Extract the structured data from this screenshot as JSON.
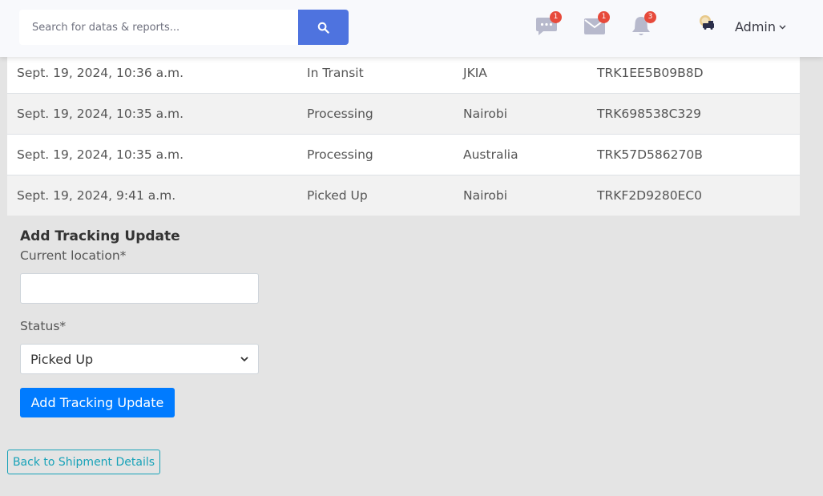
{
  "topbar": {
    "search_placeholder": "Search for datas & reports...",
    "messages_count": "1",
    "mail_count": "1",
    "alerts_count": "3",
    "user_name": "Admin"
  },
  "tracking_rows": [
    {
      "date": "Sept. 19, 2024, 10:36 a.m.",
      "status": "In Transit",
      "location": "JKIA",
      "tracking": "TRK1EE5B09B8D"
    },
    {
      "date": "Sept. 19, 2024, 10:35 a.m.",
      "status": "Processing",
      "location": "Nairobi",
      "tracking": "TRK698538C329"
    },
    {
      "date": "Sept. 19, 2024, 10:35 a.m.",
      "status": "Processing",
      "location": "Australia",
      "tracking": "TRK57D586270B"
    },
    {
      "date": "Sept. 19, 2024, 9:41 a.m.",
      "status": "Picked Up",
      "location": "Nairobi",
      "tracking": "TRKF2D9280EC0"
    }
  ],
  "form": {
    "title": "Add Tracking Update",
    "location_label": "Current location*",
    "location_value": "",
    "status_label": "Status*",
    "status_selected": "Picked Up",
    "submit_label": "Add Tracking Update"
  },
  "back_label": "Back to Shipment Details",
  "colors": {
    "primary": "#4e73df",
    "button": "#007bff",
    "badge": "#e74a3b",
    "outline": "#17a2b8"
  }
}
